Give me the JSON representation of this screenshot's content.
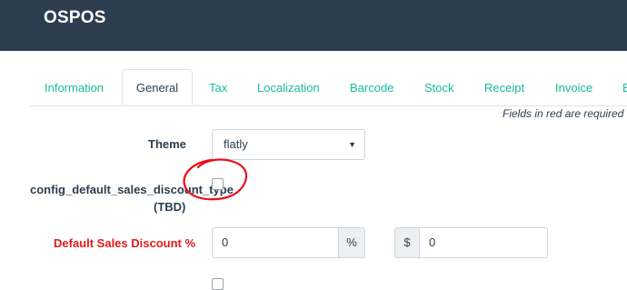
{
  "app": {
    "brand": "OSPOS"
  },
  "tabs": [
    {
      "label": "Information"
    },
    {
      "label": "General"
    },
    {
      "label": "Tax"
    },
    {
      "label": "Localization"
    },
    {
      "label": "Barcode"
    },
    {
      "label": "Stock"
    },
    {
      "label": "Receipt"
    },
    {
      "label": "Invoice"
    },
    {
      "label": "E"
    }
  ],
  "active_tab": "General",
  "required_note": "Fields in red are required",
  "form": {
    "theme": {
      "label": "Theme",
      "value": "flatly"
    },
    "discount_type": {
      "label_line1": "config_default_sales_discount_type",
      "label_line2": "(TBD)",
      "checked": false
    },
    "default_discount": {
      "label": "Default Sales Discount %",
      "percent_value": "0",
      "percent_addon": "%",
      "currency_addon": "$",
      "currency_value": "0"
    }
  },
  "colors": {
    "navbar": "#2c3e50",
    "tab_link": "#18bc9c",
    "required_label": "#e31b1b",
    "annotation": "#e8101a"
  }
}
